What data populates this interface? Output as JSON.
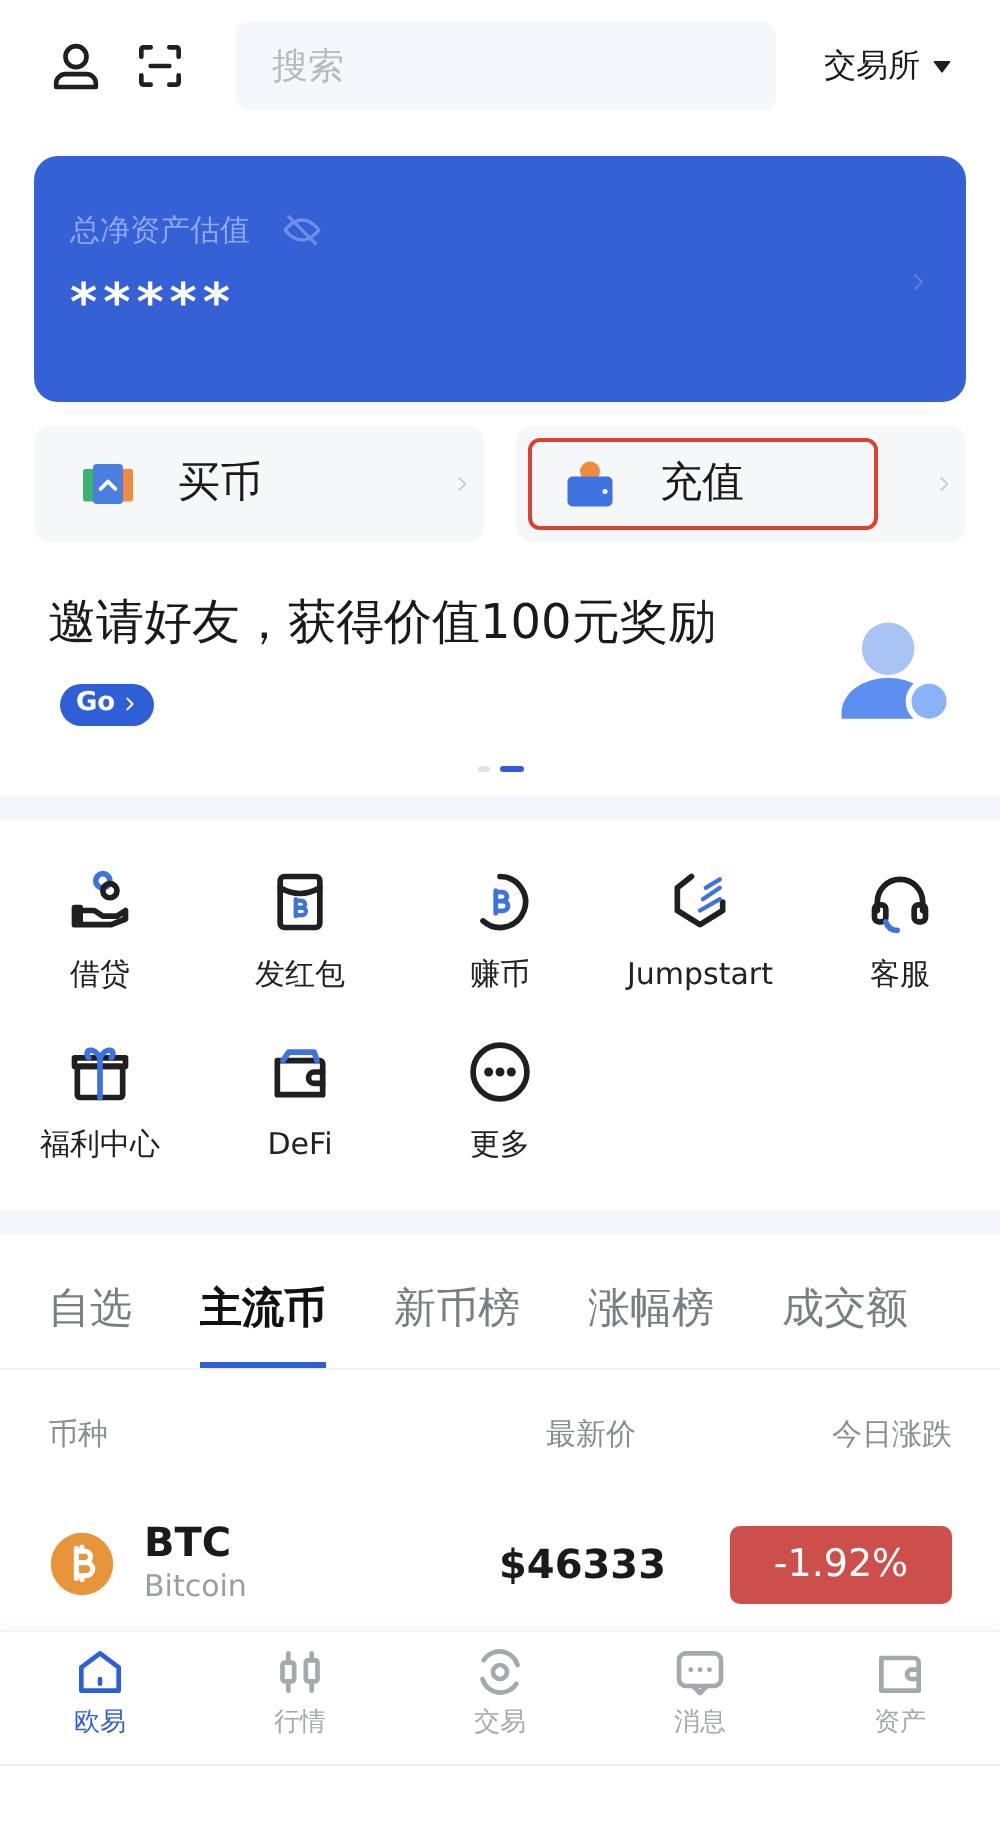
{
  "header": {
    "search": {
      "placeholder": "搜索"
    },
    "exchange_menu": {
      "label": "交易所"
    }
  },
  "asset_card": {
    "title": "总净资产估值",
    "value": "*****",
    "hidden": true
  },
  "quick_actions": [
    {
      "kind": "buy",
      "label": "买币",
      "highlighted": false
    },
    {
      "kind": "deposit",
      "label": "充值",
      "highlighted": true
    }
  ],
  "banner": {
    "text": "邀请好友，获得价值100元奖励",
    "button": "Go"
  },
  "carousel_dots": [
    {
      "selected": false
    },
    {
      "selected": true
    }
  ],
  "shortcuts": [
    {
      "kind": "loan",
      "label": "借贷"
    },
    {
      "kind": "redpacket",
      "label": "发红包"
    },
    {
      "kind": "earn",
      "label": "赚币"
    },
    {
      "kind": "jumpstart",
      "label": "Jumpstart"
    },
    {
      "kind": "support",
      "label": "客服"
    },
    {
      "kind": "gift",
      "label": "福利中心"
    },
    {
      "kind": "wallet",
      "label": "DeFi"
    },
    {
      "kind": "more",
      "label": "更多"
    }
  ],
  "market_tabs": [
    {
      "label": "自选",
      "selected": false
    },
    {
      "label": "主流币",
      "selected": true
    },
    {
      "label": "新币榜",
      "selected": false
    },
    {
      "label": "涨幅榜",
      "selected": false
    },
    {
      "label": "成交额",
      "selected": false
    }
  ],
  "table": {
    "columns": [
      "币种",
      "最新价",
      "今日涨跌"
    ],
    "rows": [
      {
        "symbol": "BTC",
        "name": "Bitcoin",
        "price": "$46333",
        "change": "-1.92%",
        "color": "#cd4f4c"
      }
    ]
  },
  "bottom_nav": [
    {
      "kind": "home",
      "label": "欧易",
      "selected": true
    },
    {
      "kind": "chart",
      "label": "行情",
      "selected": false
    },
    {
      "kind": "trade",
      "label": "交易",
      "selected": false
    },
    {
      "kind": "message",
      "label": "消息",
      "selected": false
    },
    {
      "kind": "wallet",
      "label": "资产",
      "selected": false
    }
  ]
}
